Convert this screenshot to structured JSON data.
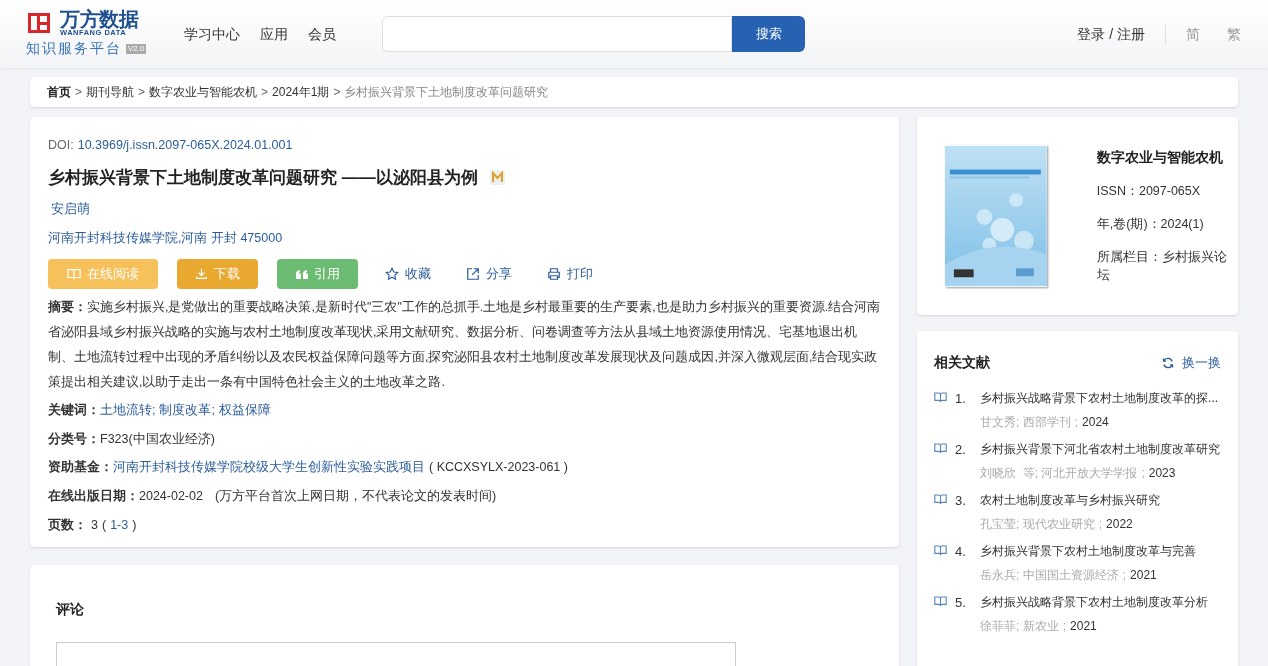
{
  "header": {
    "logo_title": "万方数据",
    "logo_subtitle": "WANFANG DATA",
    "platform": "知识服务平台",
    "version": "V2.0",
    "nav": [
      "学习中心",
      "应用",
      "会员"
    ],
    "search_button": "搜索",
    "login": "登录 / 注册",
    "lang": [
      {
        "label": "简",
        "selected": false
      },
      {
        "label": "繁",
        "selected": false
      }
    ]
  },
  "breadcrumb": [
    {
      "label": "首页",
      "kind": "home"
    },
    {
      "separator": ">",
      "label": "期刊导航",
      "kind": "link"
    },
    {
      "separator": ">",
      "label": "数字农业与智能农机",
      "kind": "link"
    },
    {
      "separator": ">",
      "label": "2024年1期",
      "kind": "link"
    },
    {
      "separator": ">",
      "label": "乡村振兴背景下土地制度改革问题研究",
      "kind": "current"
    }
  ],
  "article": {
    "doi_label": "DOI:",
    "doi": "10.3969/j.issn.2097-065X.2024.01.001",
    "title": "乡村振兴背景下土地制度改革问题研究 ——以泌阳县为例",
    "author": "安启萌",
    "affiliation": "河南开封科技传媒学院,河南 开封 475000",
    "actions": [
      {
        "label": "在线阅读",
        "kind": "read"
      },
      {
        "label": "下载",
        "kind": "download"
      },
      {
        "label": "引用",
        "kind": "cite"
      },
      {
        "label": "收藏",
        "kind": "star"
      },
      {
        "label": "分享",
        "kind": "share"
      },
      {
        "label": "打印",
        "kind": "print"
      }
    ],
    "abstract_label": "摘要：",
    "abstract": "实施乡村振兴,是党做出的重要战略决策,是新时代\"三农\"工作的总抓手.土地是乡村最重要的生产要素,也是助力乡村振兴的重要资源.结合河南省泌阳县域乡村振兴战略的实施与农村土地制度改革现状,采用文献研究、数据分析、问卷调查等方法从县域土地资源使用情况、宅基地退出机制、土地流转过程中出现的矛盾纠纷以及农民权益保障问题等方面,探究泌阳县农村土地制度改革发展现状及问题成因,并深入微观层面,结合现实政策提出相关建议,以助于走出一条有中国特色社会主义的土地改革之路.",
    "keywords_label": "关键词：",
    "keywords": [
      {
        "text": "土地流转",
        "sep": ";"
      },
      {
        "text": "制度改革",
        "sep": ";"
      },
      {
        "text": "权益保障"
      }
    ],
    "class_label": "分类号：",
    "class_value": "F323(中国农业经济)",
    "fund_label": "资助基金：",
    "fund_link": "河南开封科技传媒学院校级大学生创新性实验实践项目",
    "fund_code": "( KCCXSYLX-2023-061 )",
    "date_label": "在线出版日期：",
    "date": "2024-02-02",
    "date_note": "(万方平台首次上网日期，不代表论文的发表时间)",
    "pages_label": "页数：",
    "pages": "3",
    "pages_open": "(",
    "pages_range": "1-3",
    "pages_close": ")"
  },
  "journal": {
    "name": "数字农业与智能农机",
    "issn": "ISSN：2097-065X",
    "issue": "年,卷(期)：2024(1)",
    "column": "所属栏目：乡村振兴论坛"
  },
  "related": {
    "title": "相关文献",
    "refresh": "换一换",
    "items": [
      {
        "num": "1.",
        "title": "乡村振兴战略背景下农村土地制度改革的探...",
        "source": "甘文秀; 西部学刊",
        "sep": ";",
        "year": "2024"
      },
      {
        "num": "2.",
        "title": "乡村振兴背景下河北省农村土地制度改革研究",
        "source": "刘晓欣  等; 河北开放大学学报",
        "sep": ";",
        "year": "2023"
      },
      {
        "num": "3.",
        "title": "农村土地制度改革与乡村振兴研究",
        "source": "孔宝莹; 现代农业研究",
        "sep": ";",
        "year": "2022"
      },
      {
        "num": "4.",
        "title": "乡村振兴背景下农村土地制度改革与完善",
        "source": "岳永兵; 中国国土资源经济",
        "sep": ";",
        "year": "2021"
      },
      {
        "num": "5.",
        "title": "乡村振兴战略背景下农村土地制度改革分析",
        "source": "徐菲菲; 新农业",
        "sep": ";",
        "year": "2021"
      }
    ]
  },
  "comments": {
    "title": "评论"
  }
}
